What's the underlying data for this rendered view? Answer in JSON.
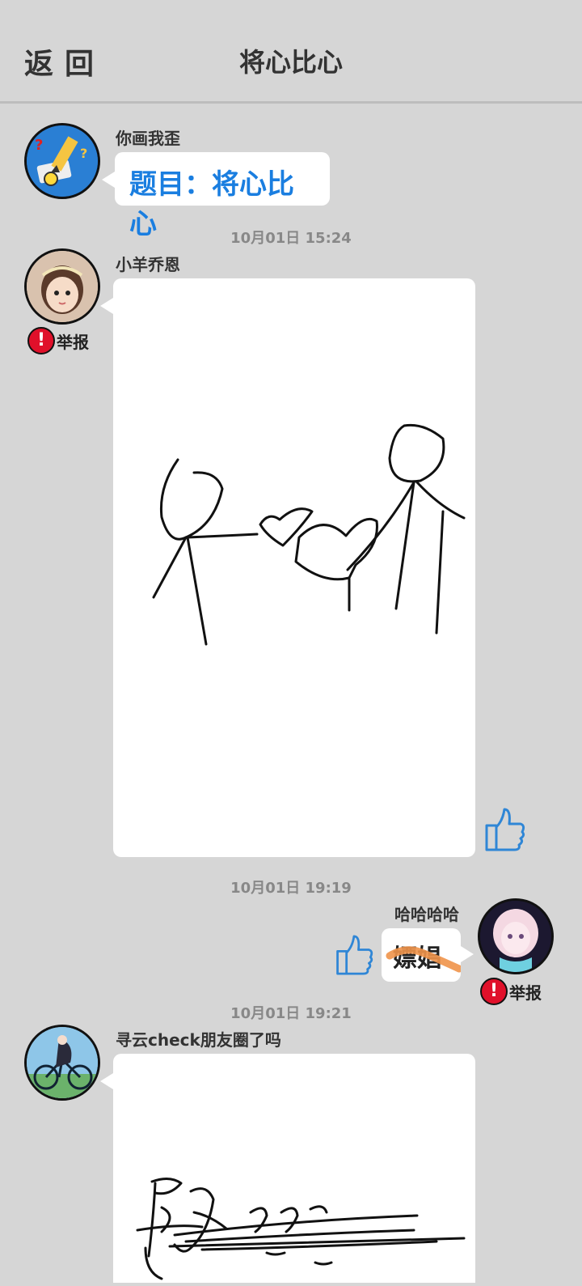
{
  "header": {
    "back_label": "返回",
    "title": "将心比心"
  },
  "messages": [
    {
      "sender": "你画我歪",
      "text": "题目：将心比心"
    },
    {
      "time": "10月01日  15:24",
      "sender": "小羊乔恩",
      "report": "举报"
    },
    {
      "time": "10月01日  19:19",
      "sender": "哈哈哈哈",
      "text": "嫖娼",
      "report": "举报"
    },
    {
      "time": "10月01日  19:21",
      "sender": "寻云check朋友圈了吗"
    }
  ],
  "icons": {
    "report": "exclamation-icon",
    "like": "thumbs-up-icon"
  },
  "colors": {
    "background": "#d6d6d6",
    "topic_text": "#1a7ee0",
    "report_icon": "#e0102a",
    "like_icon": "#2f86d6",
    "scribble": "#f0944a"
  }
}
